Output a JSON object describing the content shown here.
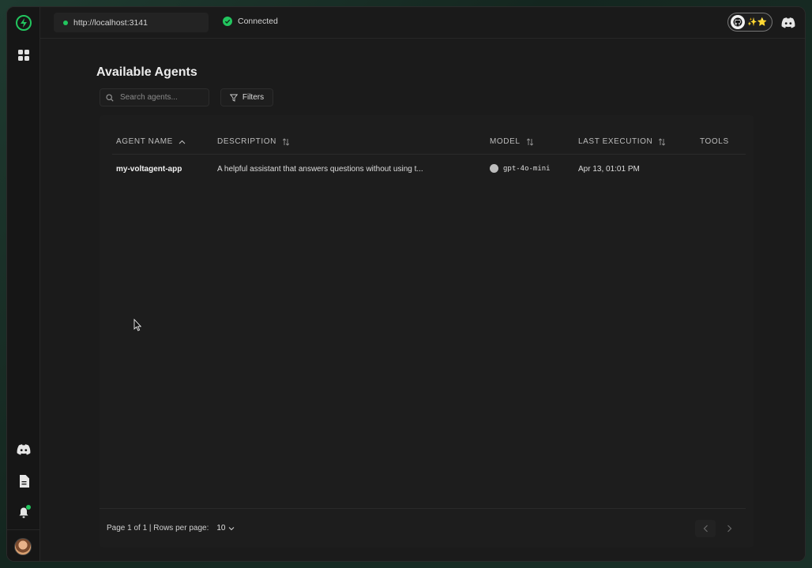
{
  "topbar": {
    "url": "http://localhost:3141",
    "status": "Connected",
    "github_badge": "✨⭐"
  },
  "sidebar": {
    "items": [
      {
        "name": "logo"
      },
      {
        "name": "agents"
      },
      {
        "name": "discord"
      },
      {
        "name": "docs"
      },
      {
        "name": "notifications"
      },
      {
        "name": "profile"
      }
    ]
  },
  "main": {
    "title": "Available Agents",
    "search_placeholder": "Search agents...",
    "filters_label": "Filters"
  },
  "table": {
    "columns": [
      "AGENT NAME",
      "DESCRIPTION",
      "MODEL",
      "LAST EXECUTION",
      "TOOLS"
    ],
    "rows": [
      {
        "name": "my-voltagent-app",
        "description": "A helpful assistant that answers questions without using t...",
        "model": "gpt-4o-mini",
        "last_execution": "Apr 13, 01:01 PM",
        "tools": ""
      }
    ]
  },
  "footer": {
    "page_info": "Page 1 of 1 | Rows per page:",
    "rows_per_page": "10"
  },
  "colors": {
    "accent": "#22c55e",
    "background": "#1b1b1b",
    "panel": "#1d1d1d"
  }
}
